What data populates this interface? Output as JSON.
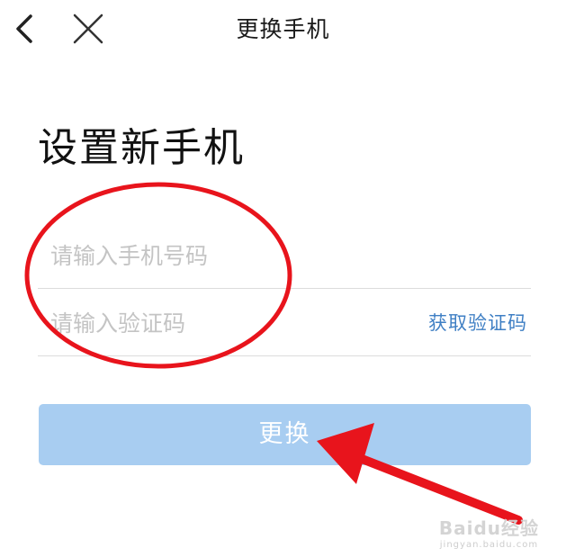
{
  "nav": {
    "title": "更换手机",
    "back_icon": "chevron-left-icon",
    "close_icon": "close-icon"
  },
  "heading": "设置新手机",
  "form": {
    "phone_placeholder": "请输入手机号码",
    "phone_value": "",
    "code_placeholder": "请输入验证码",
    "code_value": "",
    "get_code_label": "获取验证码",
    "submit_label": "更换"
  },
  "watermark": {
    "main": "Baidu经验",
    "sub": "jingyan.baidu.com"
  },
  "colors": {
    "link": "#3f7fc4",
    "button_disabled_bg": "#a8cdf1",
    "annotation_red": "#e8141c"
  }
}
